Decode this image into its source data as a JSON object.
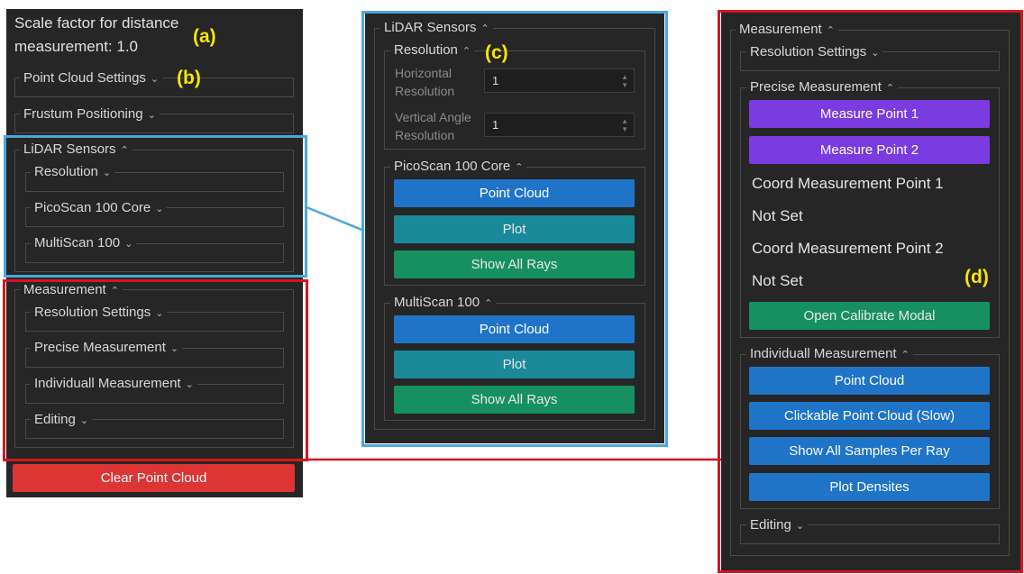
{
  "left_panel": {
    "scale_line1": "Scale factor for distance",
    "scale_line2": "measurement: 1.0",
    "point_cloud_settings": "Point Cloud Settings",
    "frustum_positioning": "Frustum Positioning",
    "lidar": {
      "title": "LiDAR Sensors",
      "items": [
        "Resolution",
        "PicoScan 100 Core",
        "MultiScan 100"
      ]
    },
    "measurement": {
      "title": "Measurement",
      "items": [
        "Resolution Settings",
        "Precise Measurement",
        "Individuall Measurement",
        "Editing"
      ]
    },
    "clear_button": "Clear Point Cloud"
  },
  "middle_panel": {
    "title": "LiDAR Sensors",
    "resolution": {
      "title": "Resolution",
      "horizontal_label_1": "Horizontal",
      "horizontal_label_2": "Resolution",
      "horizontal_value": "1",
      "vertical_label_1": "Vertical Angle",
      "vertical_label_2": "Resolution",
      "vertical_value": "1"
    },
    "picoscan": {
      "title": "PicoScan 100 Core",
      "point_cloud": "Point Cloud",
      "plot": "Plot",
      "show_all_rays": "Show All Rays"
    },
    "multiscan": {
      "title": "MultiScan 100",
      "point_cloud": "Point Cloud",
      "plot": "Plot",
      "show_all_rays": "Show All Rays"
    }
  },
  "right_panel": {
    "title": "Measurement",
    "resolution_settings": "Resolution Settings",
    "precise": {
      "title": "Precise Measurement",
      "measure_point_1": "Measure Point 1",
      "measure_point_2": "Measure Point 2",
      "coord_1_label": "Coord Measurement Point 1",
      "coord_1_value": "Not Set",
      "coord_2_label": "Coord Measurement Point 2",
      "coord_2_value": "Not Set",
      "calibrate": "Open Calibrate Modal"
    },
    "individual": {
      "title": "Individuall Measurement",
      "point_cloud": "Point Cloud",
      "clickable": "Clickable Point Cloud (Slow)",
      "show_samples": "Show All Samples Per Ray",
      "plot_densites": "Plot Densites"
    },
    "editing": "Editing"
  },
  "annotations": {
    "a": "(a)",
    "b": "(b)",
    "c": "(c)",
    "d": "(d)"
  },
  "colors": {
    "panel_bg": "#262626",
    "purple": "#7a3be0",
    "blue": "#1f74c8",
    "teal": "#1a8a9a",
    "green": "#169061",
    "red": "#dd3434",
    "highlight_blue": "#4aa8dc",
    "highlight_red": "#d8141e",
    "annotation_yellow": "#f7e600"
  },
  "icons": {
    "expanded": "chevron-up-icon",
    "collapsed": "chevron-down-icon"
  }
}
